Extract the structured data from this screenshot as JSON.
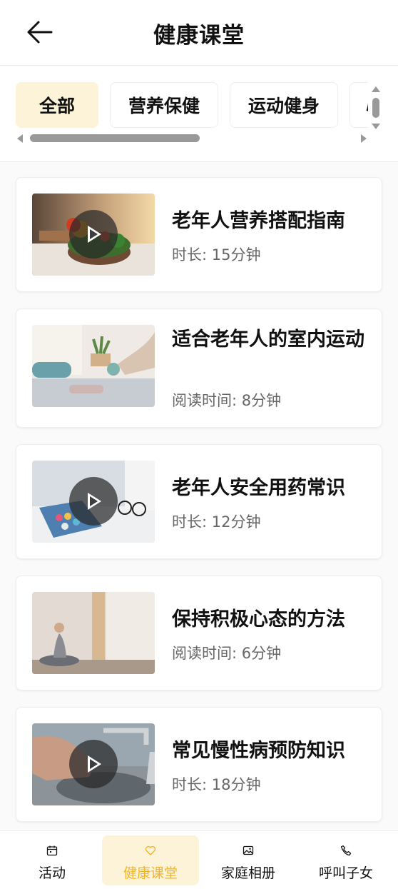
{
  "header": {
    "title": "健康课堂"
  },
  "tabs": [
    {
      "label": "全部",
      "active": true
    },
    {
      "label": "营养保健",
      "active": false
    },
    {
      "label": "运动健身",
      "active": false
    },
    {
      "label": "心",
      "active": false
    }
  ],
  "articles": [
    {
      "title": "老年人营养搭配指南",
      "meta": "时长: 15分钟",
      "type": "video",
      "image": "vegetable-bowl"
    },
    {
      "title": "适合老年人的室内运动",
      "meta": "阅读时间: 8分钟",
      "type": "article",
      "image": "indoor-exercise"
    },
    {
      "title": "老年人安全用药常识",
      "meta": "时长: 12分钟",
      "type": "video",
      "image": "pill-box"
    },
    {
      "title": "保持积极心态的方法",
      "meta": "阅读时间: 6分钟",
      "type": "article",
      "image": "meditation"
    },
    {
      "title": "常见慢性病预防知识",
      "meta": "时长: 18分钟",
      "type": "video",
      "image": "hand-washing"
    }
  ],
  "bottom_nav": [
    {
      "label": "活动",
      "icon": "calendar-icon",
      "active": false
    },
    {
      "label": "健康课堂",
      "icon": "heart-icon",
      "active": true
    },
    {
      "label": "家庭相册",
      "icon": "image-icon",
      "active": false
    },
    {
      "label": "呼叫子女",
      "icon": "phone-icon",
      "active": false
    }
  ],
  "colors": {
    "accent": "#f0b429",
    "accent_bg": "#fdf3d9"
  }
}
